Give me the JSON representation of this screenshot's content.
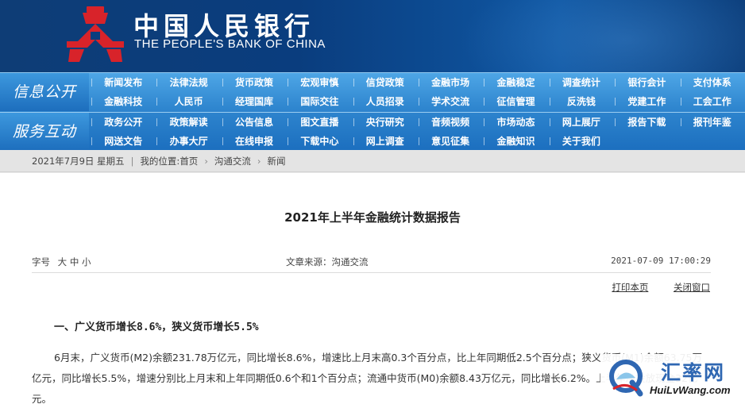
{
  "header": {
    "title_cn": "中国人民银行",
    "title_en": "THE PEOPLE'S BANK OF CHINA"
  },
  "nav": {
    "section1_label": "信息公开",
    "section1_items": [
      "新闻发布",
      "法律法规",
      "货币政策",
      "宏观审慎",
      "信贷政策",
      "金融市场",
      "金融稳定",
      "调查统计",
      "银行会计",
      "支付体系",
      "金融科技",
      "人民币",
      "经理国库",
      "国际交往",
      "人员招录",
      "学术交流",
      "征信管理",
      "反洗钱",
      "党建工作",
      "工会工作"
    ],
    "section2_label": "服务互动",
    "section2_items": [
      "政务公开",
      "政策解读",
      "公告信息",
      "图文直播",
      "央行研究",
      "音频视频",
      "市场动态",
      "网上展厅",
      "报告下载",
      "报刊年鉴",
      "网送文告",
      "办事大厅",
      "在线申报",
      "下载中心",
      "网上调查",
      "意见征集",
      "金融知识",
      "关于我们",
      "",
      ""
    ]
  },
  "breadcrumb": {
    "date": "2021年7月9日 星期五",
    "location_label": "我的位置:",
    "items": [
      "首页",
      "沟通交流",
      "新闻"
    ]
  },
  "article": {
    "title": "2021年上半年金融统计数据报告",
    "font_label": "字号",
    "font_sizes": [
      "大",
      "中",
      "小"
    ],
    "source": "文章来源：沟通交流",
    "time": "2021-07-09 17:00:29",
    "print_label": "打印本页",
    "close_label": "关闭窗口",
    "heading1": "一、广义货币增长8.6%，狭义货币增长5.5%",
    "para1": "6月末，广义货币(M2)余额231.78万亿元，同比增长8.6%，增速比上月末高0.3个百分点，比上年同期低2.5个百分点；狭义货币(M1)余额63.75万亿元，同比增长5.5%，增速分别比上月末和上年同期低0.6个和1个百分点；流通中货币(M0)余额8.43万亿元，同比增长6.2%。上半年净投放现金32亿元。"
  },
  "watermark": {
    "cn": "汇率网",
    "en": "HuiLvWang.com"
  },
  "colors": {
    "header_bg": "#0a3d7e",
    "nav_bg": "#2f86cf",
    "logo_red": "#d8232a"
  }
}
